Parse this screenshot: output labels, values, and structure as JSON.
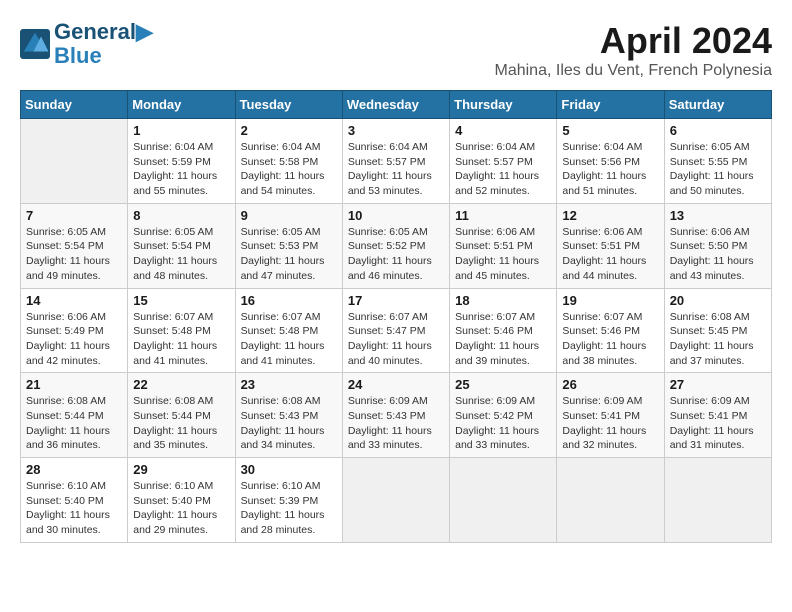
{
  "header": {
    "logo_line1": "General",
    "logo_line2": "Blue",
    "month": "April 2024",
    "location": "Mahina, Iles du Vent, French Polynesia"
  },
  "weekdays": [
    "Sunday",
    "Monday",
    "Tuesday",
    "Wednesday",
    "Thursday",
    "Friday",
    "Saturday"
  ],
  "weeks": [
    [
      {
        "day": "",
        "info": ""
      },
      {
        "day": "1",
        "info": "Sunrise: 6:04 AM\nSunset: 5:59 PM\nDaylight: 11 hours\nand 55 minutes."
      },
      {
        "day": "2",
        "info": "Sunrise: 6:04 AM\nSunset: 5:58 PM\nDaylight: 11 hours\nand 54 minutes."
      },
      {
        "day": "3",
        "info": "Sunrise: 6:04 AM\nSunset: 5:57 PM\nDaylight: 11 hours\nand 53 minutes."
      },
      {
        "day": "4",
        "info": "Sunrise: 6:04 AM\nSunset: 5:57 PM\nDaylight: 11 hours\nand 52 minutes."
      },
      {
        "day": "5",
        "info": "Sunrise: 6:04 AM\nSunset: 5:56 PM\nDaylight: 11 hours\nand 51 minutes."
      },
      {
        "day": "6",
        "info": "Sunrise: 6:05 AM\nSunset: 5:55 PM\nDaylight: 11 hours\nand 50 minutes."
      }
    ],
    [
      {
        "day": "7",
        "info": "Sunrise: 6:05 AM\nSunset: 5:54 PM\nDaylight: 11 hours\nand 49 minutes."
      },
      {
        "day": "8",
        "info": "Sunrise: 6:05 AM\nSunset: 5:54 PM\nDaylight: 11 hours\nand 48 minutes."
      },
      {
        "day": "9",
        "info": "Sunrise: 6:05 AM\nSunset: 5:53 PM\nDaylight: 11 hours\nand 47 minutes."
      },
      {
        "day": "10",
        "info": "Sunrise: 6:05 AM\nSunset: 5:52 PM\nDaylight: 11 hours\nand 46 minutes."
      },
      {
        "day": "11",
        "info": "Sunrise: 6:06 AM\nSunset: 5:51 PM\nDaylight: 11 hours\nand 45 minutes."
      },
      {
        "day": "12",
        "info": "Sunrise: 6:06 AM\nSunset: 5:51 PM\nDaylight: 11 hours\nand 44 minutes."
      },
      {
        "day": "13",
        "info": "Sunrise: 6:06 AM\nSunset: 5:50 PM\nDaylight: 11 hours\nand 43 minutes."
      }
    ],
    [
      {
        "day": "14",
        "info": "Sunrise: 6:06 AM\nSunset: 5:49 PM\nDaylight: 11 hours\nand 42 minutes."
      },
      {
        "day": "15",
        "info": "Sunrise: 6:07 AM\nSunset: 5:48 PM\nDaylight: 11 hours\nand 41 minutes."
      },
      {
        "day": "16",
        "info": "Sunrise: 6:07 AM\nSunset: 5:48 PM\nDaylight: 11 hours\nand 41 minutes."
      },
      {
        "day": "17",
        "info": "Sunrise: 6:07 AM\nSunset: 5:47 PM\nDaylight: 11 hours\nand 40 minutes."
      },
      {
        "day": "18",
        "info": "Sunrise: 6:07 AM\nSunset: 5:46 PM\nDaylight: 11 hours\nand 39 minutes."
      },
      {
        "day": "19",
        "info": "Sunrise: 6:07 AM\nSunset: 5:46 PM\nDaylight: 11 hours\nand 38 minutes."
      },
      {
        "day": "20",
        "info": "Sunrise: 6:08 AM\nSunset: 5:45 PM\nDaylight: 11 hours\nand 37 minutes."
      }
    ],
    [
      {
        "day": "21",
        "info": "Sunrise: 6:08 AM\nSunset: 5:44 PM\nDaylight: 11 hours\nand 36 minutes."
      },
      {
        "day": "22",
        "info": "Sunrise: 6:08 AM\nSunset: 5:44 PM\nDaylight: 11 hours\nand 35 minutes."
      },
      {
        "day": "23",
        "info": "Sunrise: 6:08 AM\nSunset: 5:43 PM\nDaylight: 11 hours\nand 34 minutes."
      },
      {
        "day": "24",
        "info": "Sunrise: 6:09 AM\nSunset: 5:43 PM\nDaylight: 11 hours\nand 33 minutes."
      },
      {
        "day": "25",
        "info": "Sunrise: 6:09 AM\nSunset: 5:42 PM\nDaylight: 11 hours\nand 33 minutes."
      },
      {
        "day": "26",
        "info": "Sunrise: 6:09 AM\nSunset: 5:41 PM\nDaylight: 11 hours\nand 32 minutes."
      },
      {
        "day": "27",
        "info": "Sunrise: 6:09 AM\nSunset: 5:41 PM\nDaylight: 11 hours\nand 31 minutes."
      }
    ],
    [
      {
        "day": "28",
        "info": "Sunrise: 6:10 AM\nSunset: 5:40 PM\nDaylight: 11 hours\nand 30 minutes."
      },
      {
        "day": "29",
        "info": "Sunrise: 6:10 AM\nSunset: 5:40 PM\nDaylight: 11 hours\nand 29 minutes."
      },
      {
        "day": "30",
        "info": "Sunrise: 6:10 AM\nSunset: 5:39 PM\nDaylight: 11 hours\nand 28 minutes."
      },
      {
        "day": "",
        "info": ""
      },
      {
        "day": "",
        "info": ""
      },
      {
        "day": "",
        "info": ""
      },
      {
        "day": "",
        "info": ""
      }
    ]
  ]
}
